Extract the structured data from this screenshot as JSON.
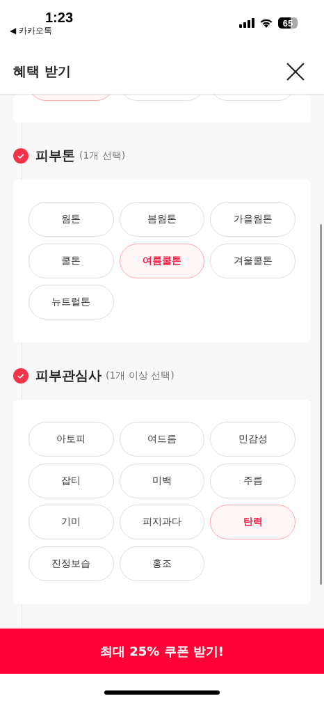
{
  "status_bar": {
    "time": "1:23",
    "back_app": "◀ 카카오톡",
    "battery": "65"
  },
  "header": {
    "title": "혜택 받기"
  },
  "partial_section": {
    "chips": [
      {
        "selected": true
      },
      {
        "selected": false
      },
      {
        "selected": false
      }
    ]
  },
  "sections": [
    {
      "title": "피부톤",
      "hint": "(1개 선택)",
      "checked": true,
      "options": [
        {
          "label": "웜톤",
          "selected": false
        },
        {
          "label": "봄웜톤",
          "selected": false
        },
        {
          "label": "가을웜톤",
          "selected": false
        },
        {
          "label": "쿨톤",
          "selected": false
        },
        {
          "label": "여름쿨톤",
          "selected": true
        },
        {
          "label": "겨울쿨톤",
          "selected": false
        },
        {
          "label": "뉴트럴톤",
          "selected": false
        }
      ]
    },
    {
      "title": "피부관심사",
      "hint": "(1개 이상 선택)",
      "checked": true,
      "options": [
        {
          "label": "아토피",
          "selected": false
        },
        {
          "label": "여드름",
          "selected": false
        },
        {
          "label": "민감성",
          "selected": false
        },
        {
          "label": "잡티",
          "selected": false
        },
        {
          "label": "미백",
          "selected": false
        },
        {
          "label": "주름",
          "selected": false
        },
        {
          "label": "기미",
          "selected": false
        },
        {
          "label": "피지과다",
          "selected": false
        },
        {
          "label": "탄력",
          "selected": true
        },
        {
          "label": "진정보습",
          "selected": false
        },
        {
          "label": "홍조",
          "selected": false
        }
      ]
    }
  ],
  "cta": {
    "label": "최대 25% 쿠폰 받기!"
  }
}
